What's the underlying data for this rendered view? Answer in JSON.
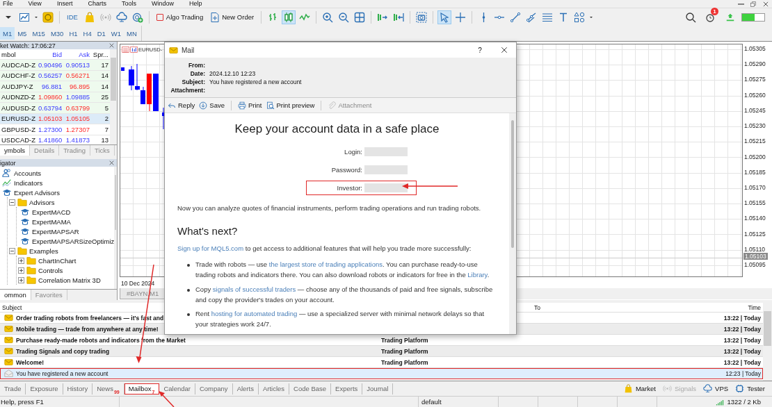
{
  "menu": [
    "File",
    "View",
    "Insert",
    "Charts",
    "Tools",
    "Window",
    "Help"
  ],
  "toolbar": {
    "ide": "IDE",
    "algo_trading": "Algo Trading",
    "new_order": "New Order",
    "chart_modes": [
      {
        "selected": false
      },
      {
        "selected": true
      },
      {
        "selected": false
      }
    ],
    "pointer_modes": [
      {
        "selected": true
      },
      {
        "selected": false
      }
    ],
    "notifications_badge": "1",
    "meter": {
      "level": 0.55
    }
  },
  "timeframes": [
    {
      "label": "M1",
      "selected": true
    },
    {
      "label": "M5",
      "selected": false
    },
    {
      "label": "M15",
      "selected": false
    },
    {
      "label": "M30",
      "selected": false
    },
    {
      "label": "H1",
      "selected": false
    },
    {
      "label": "H4",
      "selected": false
    },
    {
      "label": "D1",
      "selected": false
    },
    {
      "label": "W1",
      "selected": false
    },
    {
      "label": "MN",
      "selected": false
    }
  ],
  "market_watch": {
    "title": "ket Watch: 17:06:27",
    "columns": [
      "mbol",
      "Bid",
      "Ask",
      "Spr..."
    ],
    "rows": [
      {
        "symbol": "AUDCAD-Z",
        "bid": "0.90496",
        "bid_up": false,
        "ask": "0.90513",
        "ask_up": false,
        "spread": "17",
        "shaded": true,
        "selected": false
      },
      {
        "symbol": "AUDCHF-Z",
        "bid": "0.56257",
        "bid_up": false,
        "ask": "0.56271",
        "ask_up": true,
        "spread": "14",
        "shaded": true,
        "selected": false
      },
      {
        "symbol": "AUDJPY-Z",
        "bid": "96.881",
        "bid_up": false,
        "ask": "96.895",
        "ask_up": true,
        "spread": "14",
        "shaded": true,
        "selected": false
      },
      {
        "symbol": "AUDNZD-Z",
        "bid": "1.09860",
        "bid_up": true,
        "ask": "1.09885",
        "ask_up": false,
        "spread": "25",
        "shaded": true,
        "selected": false
      },
      {
        "symbol": "AUDUSD-Z",
        "bid": "0.63794",
        "bid_up": false,
        "ask": "0.63799",
        "ask_up": true,
        "spread": "5",
        "shaded": true,
        "selected": false
      },
      {
        "symbol": "EURUSD-Z",
        "bid": "1.05103",
        "bid_up": true,
        "ask": "1.05105",
        "ask_up": true,
        "spread": "2",
        "shaded": false,
        "selected": true
      },
      {
        "symbol": "GBPUSD-Z",
        "bid": "1.27300",
        "bid_up": false,
        "ask": "1.27307",
        "ask_up": true,
        "spread": "7",
        "shaded": false,
        "selected": false
      },
      {
        "symbol": "USDCAD-Z",
        "bid": "1.41860",
        "bid_up": false,
        "ask": "1.41873",
        "ask_up": false,
        "spread": "13",
        "shaded": false,
        "selected": false
      }
    ],
    "tabs": [
      {
        "label": "ymbols",
        "selected": true
      },
      {
        "label": "Details",
        "selected": false
      },
      {
        "label": "Trading",
        "selected": false
      },
      {
        "label": "Ticks",
        "selected": false
      }
    ]
  },
  "navigator": {
    "title": "igator",
    "tree": [
      {
        "label": "Accounts",
        "kind": "accounts"
      },
      {
        "label": "Indicators",
        "kind": "indicators"
      },
      {
        "label": "Expert Advisors",
        "kind": "experts",
        "children": [
          {
            "label": "Advisors",
            "kind": "folder",
            "expanded": true,
            "children": [
              {
                "label": "ExpertMACD",
                "kind": "expert"
              },
              {
                "label": "ExpertMAMA",
                "kind": "expert"
              },
              {
                "label": "ExpertMAPSAR",
                "kind": "expert"
              },
              {
                "label": "ExpertMAPSARSizeOptimiz",
                "kind": "expert"
              }
            ]
          },
          {
            "label": "Examples",
            "kind": "folder",
            "expanded": true,
            "children": [
              {
                "label": "ChartInChart",
                "kind": "folder",
                "expanded": false
              },
              {
                "label": "Controls",
                "kind": "folder",
                "expanded": false
              },
              {
                "label": "Correlation Matrix 3D",
                "kind": "folder",
                "expanded": false
              }
            ]
          }
        ]
      }
    ],
    "tabs": [
      {
        "label": "ommon",
        "selected": true
      },
      {
        "label": "Favorites",
        "selected": false
      }
    ]
  },
  "chart": {
    "title": "EURUSD-",
    "price_labels": [
      "1.05305",
      "1.05290",
      "1.05275",
      "1.05260",
      "1.05245",
      "1.05230",
      "1.05215",
      "1.05200",
      "1.05185",
      "1.05170",
      "1.05155",
      "1.05140",
      "1.05125",
      "1.05110",
      "1.05095"
    ],
    "current_price": "1.05103",
    "date_label": "10 Dec 2024",
    "tabs": [
      {
        "label": "#BAYN,M1"
      }
    ]
  },
  "mailbox": {
    "columns": {
      "subject": "Subject",
      "to": "To",
      "time": "Time"
    },
    "rows": [
      {
        "subject": "Order trading robots from freelancers — it's fast and",
        "time": "13:22 | Today",
        "unread": true,
        "selected": false,
        "highlighted": false
      },
      {
        "subject": "Mobile trading — trade from anywhere at any time!",
        "time": "13:22 | Today",
        "unread": true,
        "selected": false,
        "highlighted": false
      },
      {
        "subject": "Purchase ready-made robots and indicators from the Market",
        "from": "Trading Platform",
        "time": "13:22 | Today",
        "unread": true,
        "selected": false,
        "highlighted": false
      },
      {
        "subject": "Trading Signals and copy trading",
        "from": "Trading Platform",
        "time": "13:22 | Today",
        "unread": true,
        "selected": false,
        "highlighted": false
      },
      {
        "subject": "Welcome!",
        "from": "Trading Platform",
        "time": "13:22 | Today",
        "unread": true,
        "selected": false,
        "highlighted": false
      },
      {
        "subject": "You have registered a new account",
        "time": "12:23 | Today",
        "unread": false,
        "selected": true,
        "highlighted": true
      }
    ]
  },
  "toolbox_tabs": [
    {
      "label": "Trade",
      "selected": false,
      "highlighted": false
    },
    {
      "label": "Exposure",
      "selected": false,
      "highlighted": false
    },
    {
      "label": "History",
      "selected": false,
      "highlighted": false
    },
    {
      "label": "News",
      "badge": "99",
      "selected": false,
      "highlighted": false
    },
    {
      "label": "Mailbox",
      "badge": "7",
      "selected": true,
      "highlighted": true
    },
    {
      "label": "Calendar",
      "selected": false,
      "highlighted": false
    },
    {
      "label": "Company",
      "selected": false,
      "highlighted": false
    },
    {
      "label": "Alerts",
      "selected": false,
      "highlighted": false
    },
    {
      "label": "Articles",
      "selected": false,
      "highlighted": false
    },
    {
      "label": "Code Base",
      "selected": false,
      "highlighted": false
    },
    {
      "label": "Experts",
      "selected": false,
      "highlighted": false
    },
    {
      "label": "Journal",
      "selected": false,
      "highlighted": false
    }
  ],
  "toolbox_links": [
    {
      "label": "Market",
      "kind": "market",
      "disabled": false
    },
    {
      "label": "Signals",
      "kind": "signals",
      "disabled": true
    },
    {
      "label": "VPS",
      "kind": "vps",
      "disabled": false
    },
    {
      "label": "Tester",
      "kind": "tester",
      "disabled": false
    }
  ],
  "status_bar": {
    "help": "Help, press F1",
    "profile": "default",
    "traffic": "1322 / 2 Kb"
  },
  "mail": {
    "title": "Mail",
    "help": "?",
    "fields": [
      {
        "label": "From:"
      },
      {
        "label": "Date:",
        "value": "2024.12.10 12:23"
      },
      {
        "label": "Subject:",
        "value": "You have registered a new account"
      },
      {
        "label": "Attachment:"
      }
    ],
    "actions": [
      {
        "label": "Reply",
        "kind": "reply",
        "disabled": false
      },
      {
        "label": "Save",
        "kind": "save",
        "disabled": false
      },
      {
        "label": "Print",
        "kind": "print",
        "disabled": false
      },
      {
        "label": "Print preview",
        "kind": "preview",
        "disabled": false
      },
      {
        "label": "Attachment",
        "kind": "attach",
        "disabled": true
      }
    ],
    "heading": "Keep your account data in a safe place",
    "credentials": [
      {
        "label": "Login:",
        "highlighted": false
      },
      {
        "label": "Password:",
        "highlighted": false
      },
      {
        "label": "Investor:",
        "highlighted": true
      }
    ],
    "intro": "Now you can analyze quotes of financial instruments, perform trading operations and run trading robots.",
    "subheading": "What's next?",
    "signup": [
      {
        "text": "Sign up for MQL5.com",
        "link": true
      },
      {
        "text": " to get access to additional features that will help you trade more successfully:",
        "link": false
      }
    ],
    "bullets": [
      [
        {
          "text": "Trade with robots — use ",
          "link": false
        },
        {
          "text": "the largest store of trading applications",
          "link": true
        },
        {
          "text": ". You can purchase ready-to-use trading robots and indicators there. You can also download robots or indicators for free in the ",
          "link": false
        },
        {
          "text": "Library",
          "link": true
        },
        {
          "text": ".",
          "link": false
        }
      ],
      [
        {
          "text": "Copy ",
          "link": false
        },
        {
          "text": "signals of successful traders",
          "link": true
        },
        {
          "text": " — choose any of the thousands of paid and free signals, subscribe and copy the provider's trades on your account.",
          "link": false
        }
      ],
      [
        {
          "text": "Rent ",
          "link": false
        },
        {
          "text": "hosting for automated trading",
          "link": true
        },
        {
          "text": " — use a specialized server with minimal network delays so that your strategies work 24/7.",
          "link": false
        }
      ]
    ]
  }
}
